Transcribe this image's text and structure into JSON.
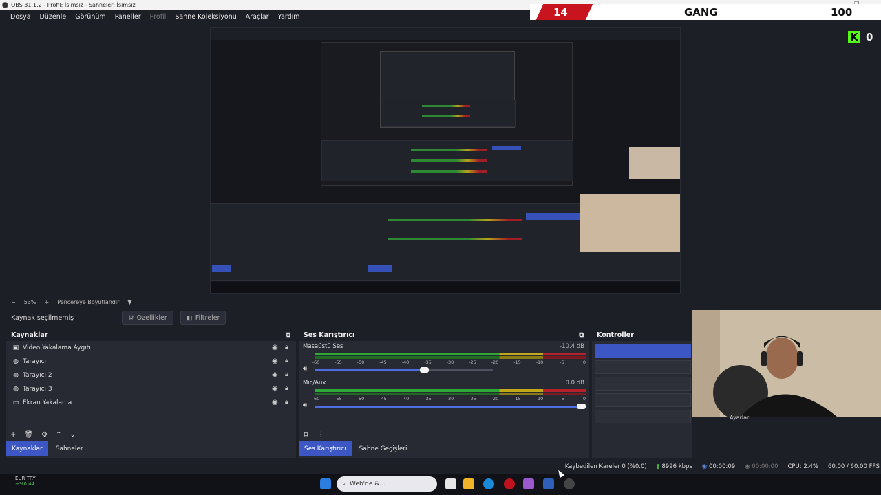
{
  "window": {
    "title": "OBS 31.1.2 - Profil: İsimsiz - Sahneler: İsimsiz"
  },
  "menu": [
    "Dosya",
    "Düzenle",
    "Görünüm",
    "Paneller",
    "Profil",
    "Sahne Koleksiyonu",
    "Araçlar",
    "Yardım"
  ],
  "scoreboard": {
    "left_score": "14",
    "team": "GANG",
    "right_score": "100",
    "kick_letter": "K",
    "kick_count": "0"
  },
  "zoom": {
    "minus": "−",
    "value": "53%",
    "plus": "+",
    "fit_label": "Pencereye Boyutlandır"
  },
  "source_toolbar": {
    "no_source": "Kaynak seçilmemiş",
    "properties": "Özellikler",
    "filters": "Filtreler"
  },
  "sources": {
    "title": "Kaynaklar",
    "items": [
      {
        "label": "Video Yakalama Aygıtı",
        "icon": "camera-icon"
      },
      {
        "label": "Tarayıcı",
        "icon": "globe-icon"
      },
      {
        "label": "Tarayıcı 2",
        "icon": "globe-icon"
      },
      {
        "label": "Tarayıcı 3",
        "icon": "globe-icon"
      },
      {
        "label": "Ekran Yakalama",
        "icon": "monitor-icon"
      }
    ],
    "tabs": [
      "Kaynaklar",
      "Sahneler"
    ]
  },
  "mixer": {
    "title": "Ses Karıştırıcı",
    "channels": [
      {
        "name": "Masaüstü Ses",
        "db": "-10.4 dB",
        "volume": 0.64
      },
      {
        "name": "Mic/Aux",
        "db": "0.0 dB",
        "volume": 1.0
      }
    ],
    "scale": [
      "-60",
      "-55",
      "-50",
      "-45",
      "-40",
      "-35",
      "-30",
      "-25",
      "-20",
      "-15",
      "-10",
      "-5",
      "0"
    ],
    "tabs": [
      "Ses Karıştırıcı",
      "Sahne Geçişleri"
    ]
  },
  "controls": {
    "title": "Kontroller",
    "settings_label": "Ayarlar"
  },
  "status": {
    "dropped": "Kaybedilen Kareler 0 (%0.0)",
    "bitrate": "8996 kbps",
    "stream_time": "00:00:09",
    "rec_time": "00:00:00",
    "cpu": "CPU: 2.4%",
    "fps": "60.00 / 60.00 FPS"
  },
  "taskbar": {
    "search_placeholder": "Web'de &...",
    "weather_line1": "EUR TRY",
    "weather_line2": "+%0.44"
  },
  "colors": {
    "accent": "#3c56c4",
    "background": "#1d1f26",
    "panel": "#272a33",
    "score_red": "#c8141e",
    "kick_green": "#53fc18"
  }
}
